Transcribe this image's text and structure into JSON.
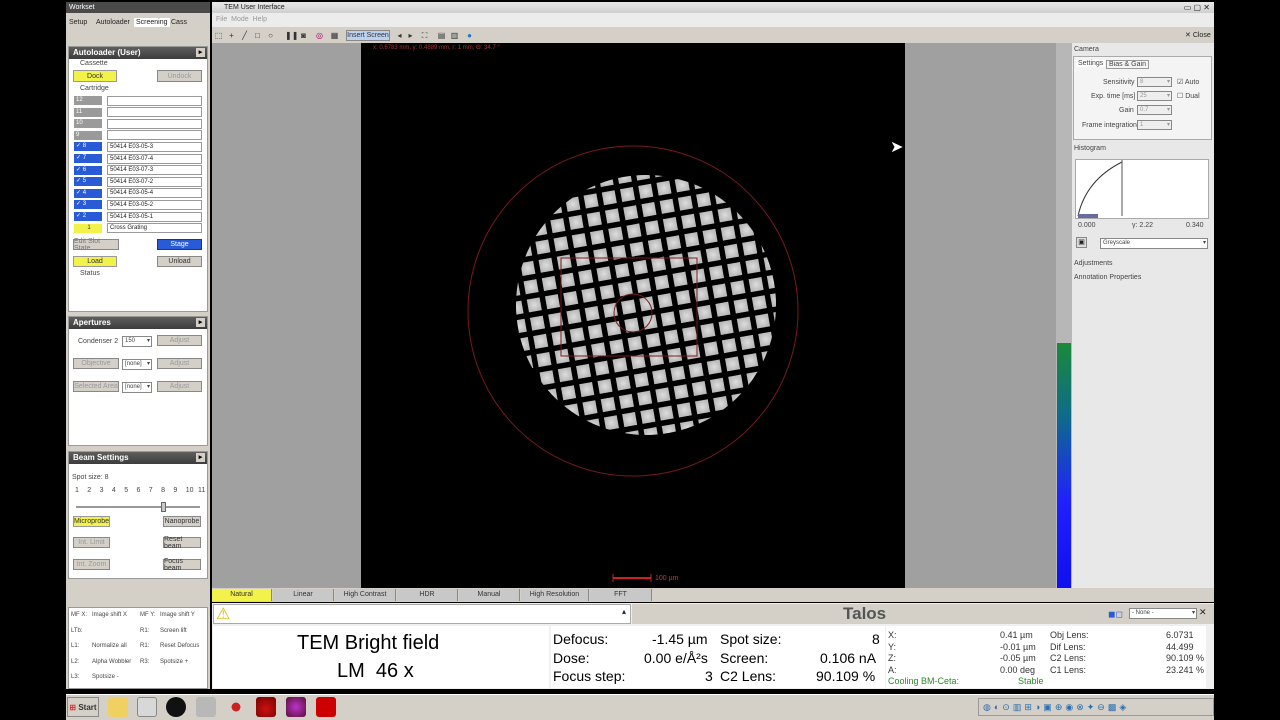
{
  "workset": {
    "title": "Workset",
    "tabs": [
      "Setup",
      "Autoloader",
      "Screening",
      "Cass"
    ]
  },
  "tem_window": {
    "title": "TEM User Interface",
    "menu": [
      "File",
      "Mode",
      "Help"
    ],
    "insert_screen": "Insert Screen",
    "coords": "x: 0.6783 mm, y: 0.4889 mm, r: 1 mm, Θ: 34.7 °",
    "close": "Close",
    "scale": "100 µm"
  },
  "autoloader": {
    "title": "Autoloader (User)",
    "cassette_label": "Cassette",
    "dock": "Dock",
    "undock": "Undock",
    "cartridge_label": "Cartridge",
    "rows": [
      {
        "num": "12",
        "name": "",
        "state": "gray"
      },
      {
        "num": "11",
        "name": "",
        "state": "gray"
      },
      {
        "num": "10",
        "name": "",
        "state": "gray"
      },
      {
        "num": "9",
        "name": "",
        "state": "gray"
      },
      {
        "num": "✓ 8",
        "name": "50414 E03-05-3",
        "state": "bl"
      },
      {
        "num": "✓ 7",
        "name": "50414 E03-07-4",
        "state": "bl"
      },
      {
        "num": "✓ 6",
        "name": "50414 E03-07-3",
        "state": "bl"
      },
      {
        "num": "✓ 5",
        "name": "50414 E03-07-2",
        "state": "bl"
      },
      {
        "num": "✓ 4",
        "name": "50414 E03-05-4",
        "state": "bl"
      },
      {
        "num": "✓ 3",
        "name": "50414 E03-05-2",
        "state": "bl"
      },
      {
        "num": "✓ 2",
        "name": "50414 E03-05-1",
        "state": "bl"
      },
      {
        "num": "1",
        "name": "Cross Grating",
        "state": "yl"
      }
    ],
    "edit_slot": "Edit Slot State",
    "stage": "Stage",
    "load": "Load",
    "unload": "Unload",
    "status_label": "Status"
  },
  "apertures": {
    "title": "Apertures",
    "condenser": "Condenser 2",
    "cond_val": "150",
    "objective": "Objective",
    "obj_val": "[none]",
    "selected": "Selected Area",
    "sel_val": "[none]",
    "adjust": "Adjust"
  },
  "beam": {
    "title": "Beam Settings",
    "spot_size": "Spot size: 8",
    "ticks": [
      "1",
      "2",
      "3",
      "4",
      "5",
      "6",
      "7",
      "8",
      "9",
      "10",
      "11"
    ],
    "spot_value": 8,
    "microprobe": "Microprobe",
    "nanoprobe": "Nanoprobe",
    "int_limit": "Int. Limit",
    "reset_beam": "Reset beam",
    "int_zoom": "Int. Zoom",
    "focus_beam": "Focus beam"
  },
  "mf": {
    "c1": [
      "MF X:",
      "LTb:",
      "L1:",
      "L2:",
      "L3:"
    ],
    "c2": [
      "Image shift X",
      "",
      "Normalize all",
      "Alpha Wobbler",
      "Spotsize -"
    ],
    "c3": [
      "MF Y:",
      "R1:",
      "R1:",
      "R3:",
      ""
    ],
    "c4": [
      "Image shift Y",
      "Screen lift",
      "Reset Defocus",
      "Spotsize +",
      ""
    ]
  },
  "filter_tabs": [
    "Natural",
    "Linear",
    "High Contrast",
    "HDR",
    "Manual",
    "High Resolution",
    "FFT"
  ],
  "camera": {
    "title": "Camera",
    "tabs": [
      "Settings",
      "Bias & Gain"
    ],
    "sensitivity": "Sensitivity",
    "sens_val": "8",
    "exp_time": "Exp. time [ms]",
    "exp_val": "25",
    "gain": "Gain",
    "gain_val": "0.7",
    "frame_int": "Frame integration",
    "frame_val": "1",
    "auto": "Auto",
    "dual": "Dual"
  },
  "histogram": {
    "title": "Histogram",
    "min": "0.000",
    "gamma": "γ: 2.22",
    "max": "0.340",
    "lut": "Greyscale"
  },
  "sections": {
    "adjust": "Adjustments",
    "annot": "Annotation Properties"
  },
  "status": {
    "brand": "Talos",
    "mode1": "TEM Bright field",
    "mode2": "LM  46 x",
    "select": "- None -",
    "defocus_l": "Defocus:",
    "defocus_v": "-1.45 µm",
    "dose_l": "Dose:",
    "dose_v": "0.00 e/Å²s",
    "focus_l": "Focus step:",
    "focus_v": "3",
    "spot_l": "Spot size:",
    "spot_v": "8",
    "screen_l": "Screen:",
    "screen_v": "0.106 nA",
    "c2_l": "C2 Lens:",
    "c2_v": "90.109 %",
    "stage": [
      [
        "X:",
        "0.41 µm"
      ],
      [
        "Y:",
        "-0.01 µm"
      ],
      [
        "Z:",
        "-0.05 µm"
      ],
      [
        "A:",
        "0.00 deg"
      ]
    ],
    "lens": [
      [
        "Obj Lens:",
        "6.0731"
      ],
      [
        "Dif Lens:",
        "44.499"
      ],
      [
        "C2 Lens:",
        "90.109 %"
      ],
      [
        "C1 Lens:",
        "23.241 %"
      ]
    ],
    "cooling": "Cooling BM-Ceta:",
    "stable": "Stable"
  },
  "taskbar": {
    "start": "Start"
  }
}
